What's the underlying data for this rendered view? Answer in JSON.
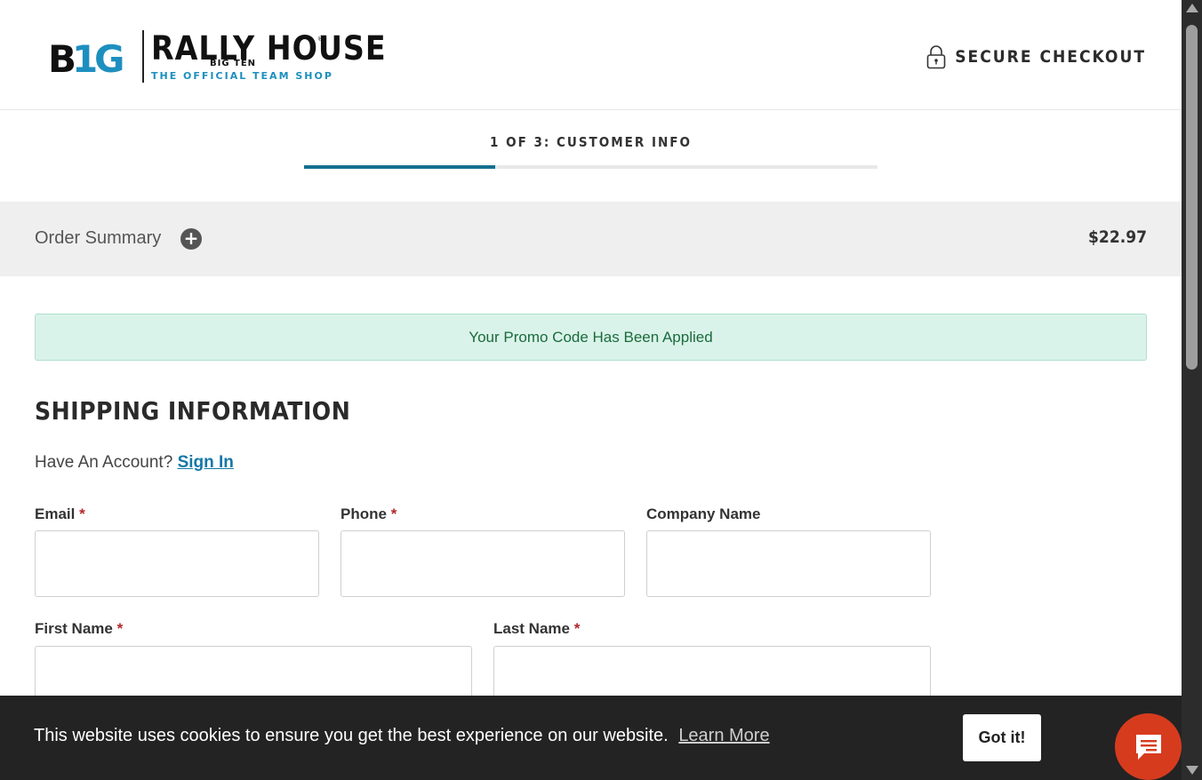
{
  "header": {
    "logo_big": "B1G",
    "logo_brand": "RALLY HOUSE",
    "logo_sub": "BIG TEN",
    "logo_tagline": "THE OFFICIAL TEAM SHOP",
    "secure_label": "SECURE CHECKOUT",
    "colors": {
      "big_blue": "#1d8fbf",
      "text": "#111111"
    }
  },
  "step": {
    "label": "1 OF 3: CUSTOMER INFO",
    "progress": 0.333,
    "progress_color": "#15708e"
  },
  "order_summary": {
    "title": "Order Summary",
    "expand_icon": "plus-circle-icon",
    "total": "$22.97"
  },
  "promo": {
    "message": "Your Promo Code Has Been Applied",
    "color": "#1a6b3c"
  },
  "shipping": {
    "heading": "SHIPPING INFORMATION",
    "account_prompt": "Have An Account?",
    "sign_in": "Sign In",
    "required_marker": "*",
    "fields": {
      "email": {
        "label": "Email",
        "value": "",
        "required": true
      },
      "phone": {
        "label": "Phone",
        "value": "",
        "required": true
      },
      "company": {
        "label": "Company Name",
        "value": "",
        "required": false
      },
      "first_name": {
        "label": "First Name",
        "value": "",
        "required": true
      },
      "last_name": {
        "label": "Last Name",
        "value": "",
        "required": true
      }
    }
  },
  "cookie": {
    "message": "This website uses cookies to ensure you get the best experience on our website.",
    "learn_more": "Learn More",
    "accept": "Got it!"
  },
  "chat": {
    "icon": "chat-bubble-icon",
    "color": "#d63b1e"
  }
}
